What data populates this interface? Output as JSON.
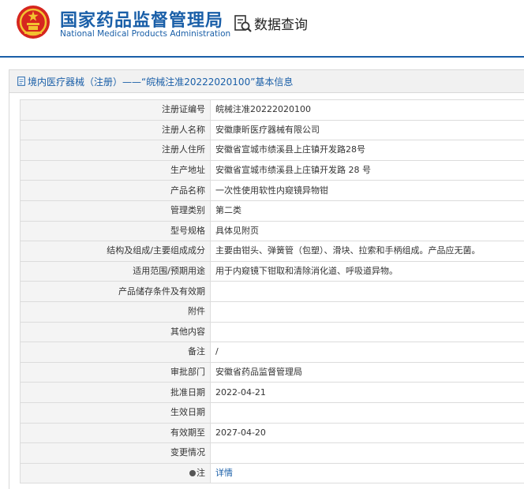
{
  "header": {
    "org_cn": "国家药品监督管理局",
    "org_en": "National Medical Products Administration",
    "emblem_icon": "national-emblem-icon",
    "query_icon": "document-search-icon",
    "query_title": "数据查询",
    "brand_color": "#1a5fa8"
  },
  "panel": {
    "title_icon": "document-icon",
    "title": "境内医疗器械（注册）——“皖械注准20222020100”基本信息"
  },
  "rows": [
    {
      "label": "注册证编号",
      "value": "皖械注准20222020100"
    },
    {
      "label": "注册人名称",
      "value": "安徽康昕医疗器械有限公司"
    },
    {
      "label": "注册人住所",
      "value": "安徽省宣城市绩溪县上庄镇开发路28号"
    },
    {
      "label": "生产地址",
      "value": "安徽省宣城市绩溪县上庄镇开发路 28 号"
    },
    {
      "label": "产品名称",
      "value": "一次性使用软性内窥镜异物钳"
    },
    {
      "label": "管理类别",
      "value": "第二类"
    },
    {
      "label": "型号规格",
      "value": "具体见附页"
    },
    {
      "label": "结构及组成/主要组成成分",
      "value": "主要由钳头、弹簧管（包塑）、滑块、拉索和手柄组成。产品应无菌。"
    },
    {
      "label": "适用范围/预期用途",
      "value": "用于内窥镜下钳取和清除消化道、呼吸道异物。"
    },
    {
      "label": "产品储存条件及有效期",
      "value": ""
    },
    {
      "label": "附件",
      "value": ""
    },
    {
      "label": "其他内容",
      "value": ""
    },
    {
      "label": "备注",
      "value": "/"
    },
    {
      "label": "审批部门",
      "value": "安徽省药品监督管理局"
    },
    {
      "label": "批准日期",
      "value": "2022-04-21"
    },
    {
      "label": "生效日期",
      "value": ""
    },
    {
      "label": "有效期至",
      "value": "2027-04-20"
    },
    {
      "label": "变更情况",
      "value": ""
    }
  ],
  "note_row": {
    "icon": "info-dot-icon",
    "label": "注",
    "link": "详情"
  }
}
